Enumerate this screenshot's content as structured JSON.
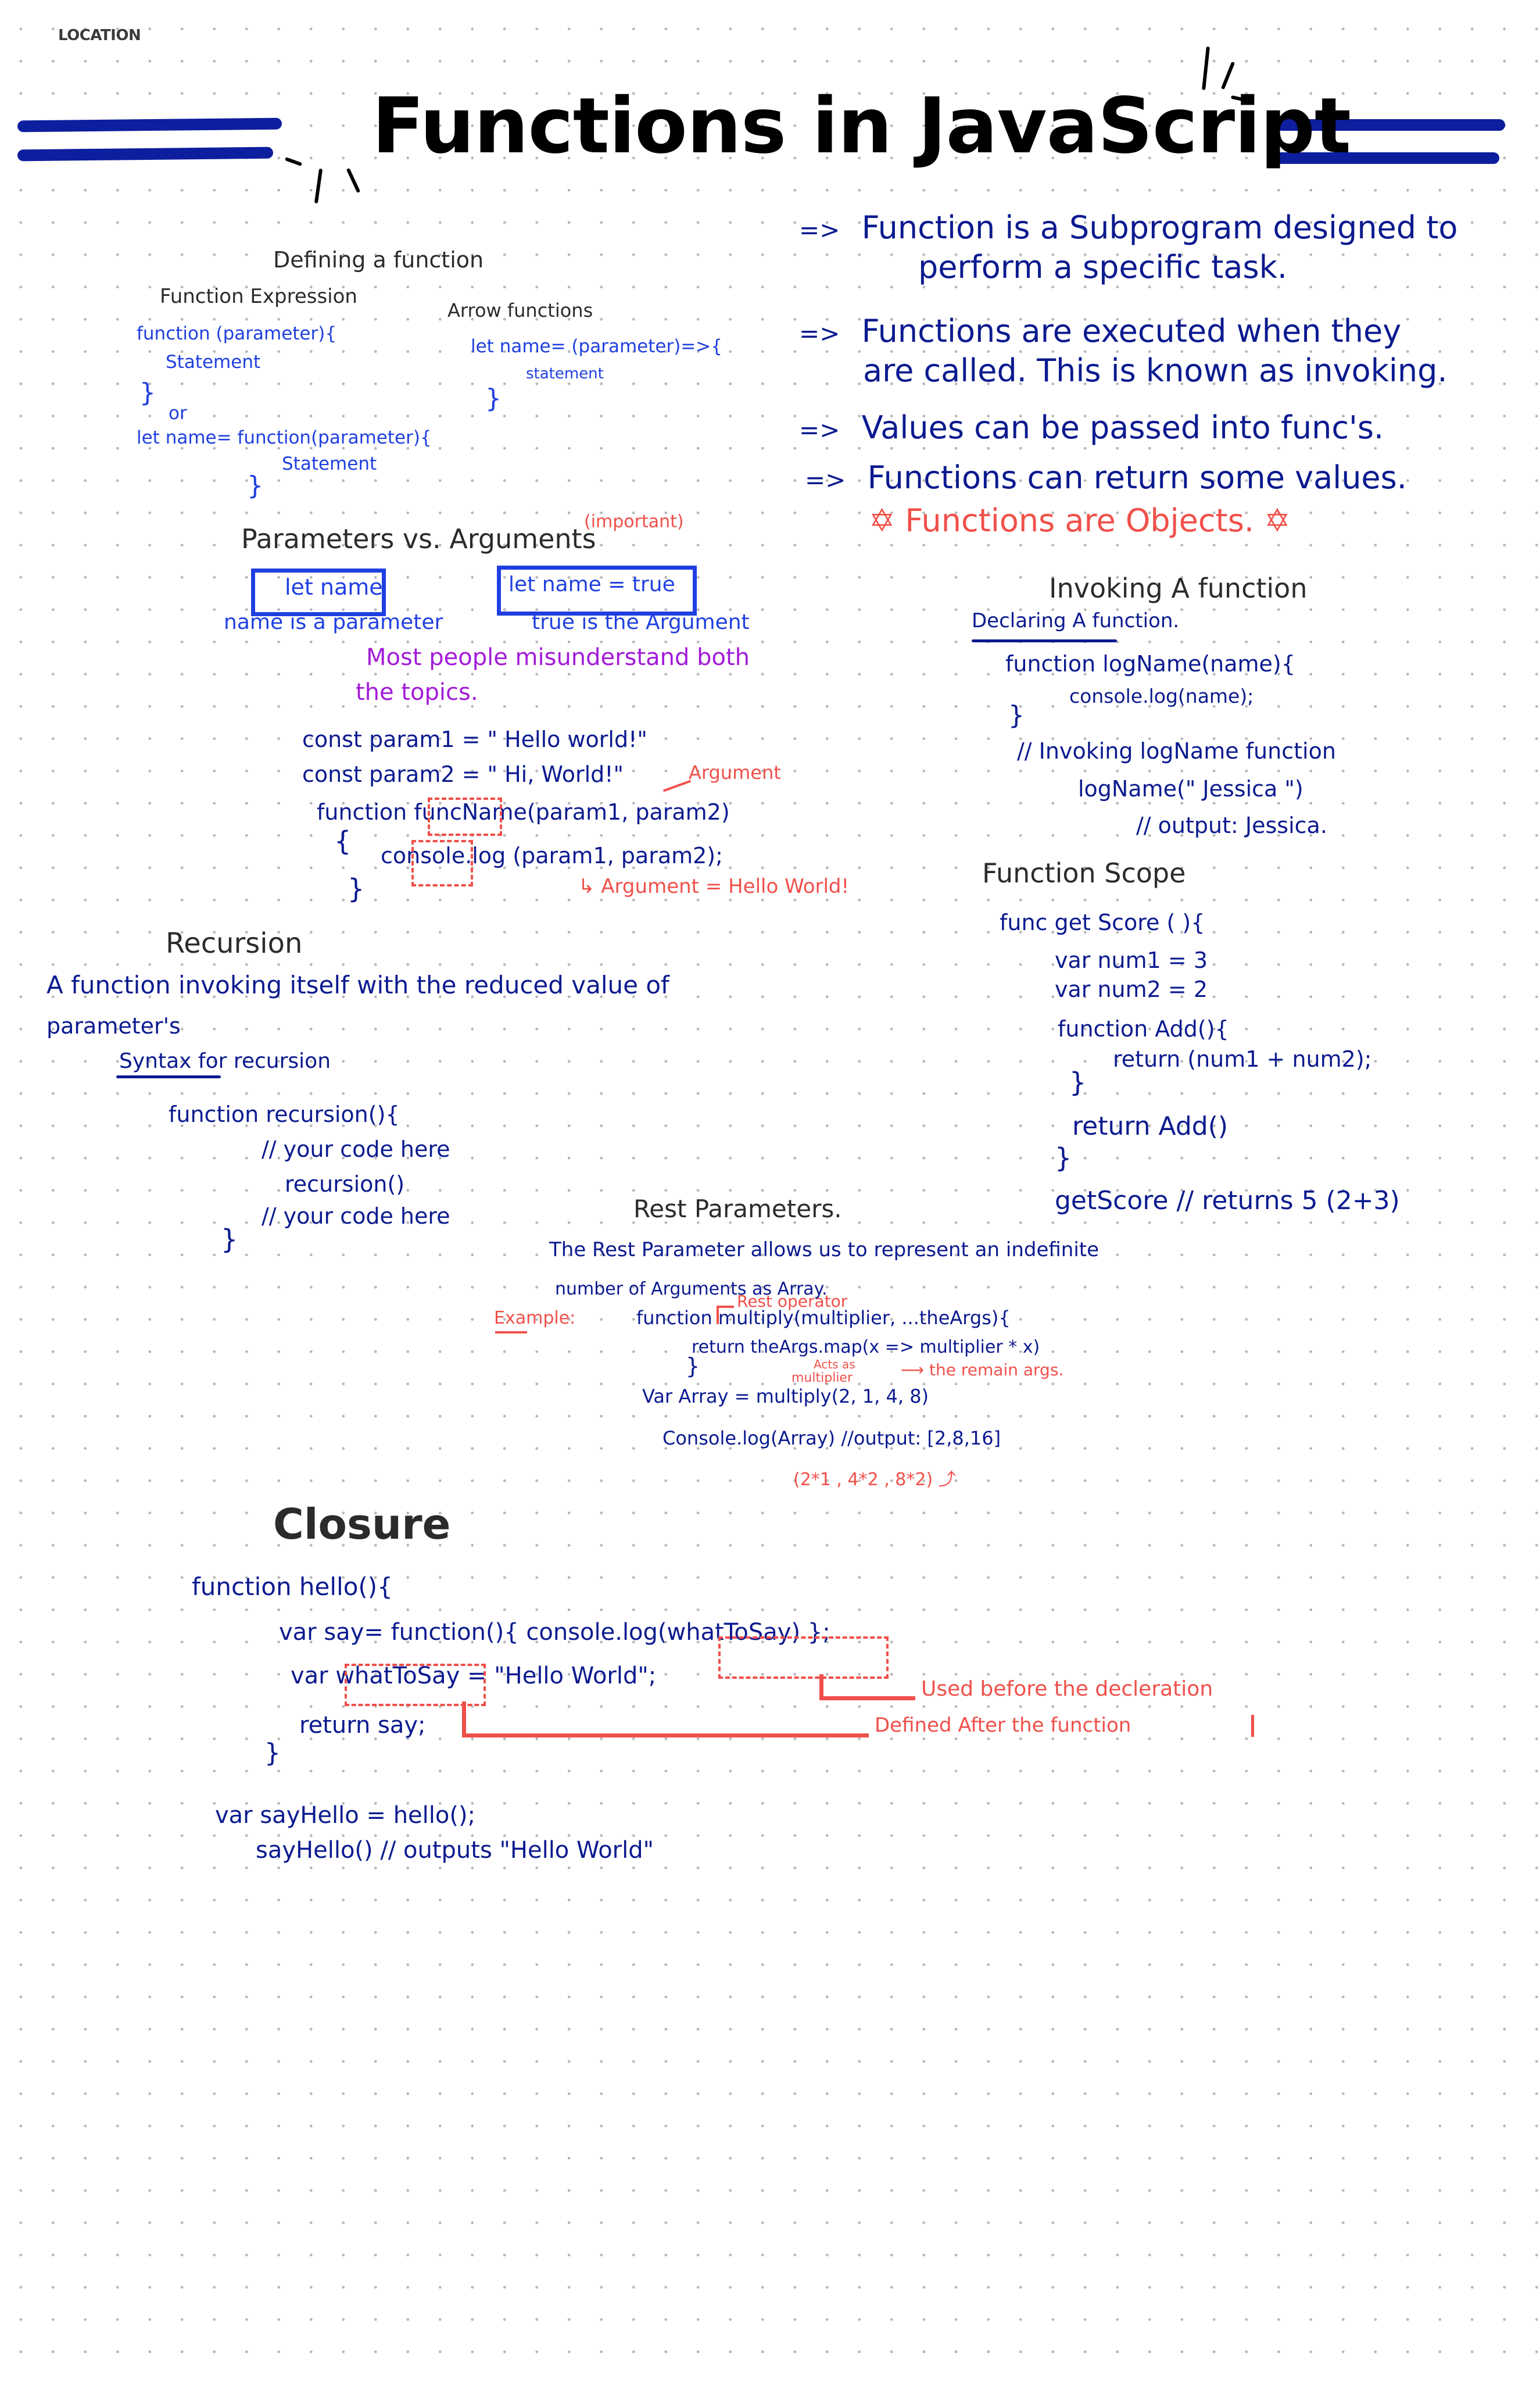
{
  "header": {
    "location_label": "LOCATION",
    "title": "Functions in JavaScript"
  },
  "colors": {
    "accent_blue": "#0b1a8f",
    "bright_blue": "#1f3fe0",
    "annotation_red": "#f0504a",
    "highlight_purple": "#a21bd8",
    "heading_dark": "#2b2b2b"
  },
  "intro_points": [
    {
      "bullet": "=>",
      "text_line1": "Function is a Subprogram designed to",
      "text_line2": "perform a specific task."
    },
    {
      "bullet": "=>",
      "text_line1": "Functions are executed when they",
      "text_line2": "are called. This is known as invoking."
    },
    {
      "bullet": "=>",
      "text_line1": "Values can be passed into func's."
    },
    {
      "bullet": "=>",
      "text_line1": "Functions can return some values."
    }
  ],
  "highlight_fact": {
    "star_icon": "star-of-david",
    "text": "Functions are Objects."
  },
  "defining": {
    "heading": "Defining a function",
    "expression": {
      "heading": "Function Expression",
      "lines": [
        "function (parameter){",
        "Statement",
        "}",
        "or",
        "let name= function(parameter){",
        "Statement",
        "}"
      ]
    },
    "arrow": {
      "heading": "Arrow functions",
      "lines": [
        "let name= (parameter)=>{",
        "statement",
        "}"
      ]
    }
  },
  "params_vs_args": {
    "heading": "Parameters vs. Arguments",
    "tag": "(important)",
    "box_left": "let name",
    "box_right": "let name = true",
    "caption_left": "name is a parameter",
    "caption_right": "true is the Argument",
    "note_line1": "Most people misunderstand both",
    "note_line2": "the topics.",
    "code": [
      "const param1 = \" Hello world!\"",
      "const param2 = \" Hi, World!\"",
      "function funcName(param1, param2)",
      "{",
      "console.log (param1, param2);",
      "}"
    ],
    "annotation_argument": "Argument",
    "annotation_result": "Argument = Hello World!"
  },
  "invoking": {
    "heading": "Invoking A function",
    "subheading": "Declaring A function.",
    "lines": [
      "function logName(name){",
      "console.log(name);",
      "}",
      "// Invoking logName function",
      "logName(\" Jessica \")",
      "// output: Jessica."
    ]
  },
  "scope": {
    "heading": "Function Scope",
    "lines": [
      "func get Score ( ){",
      "var num1 = 3",
      "var num2 = 2",
      "function Add(){",
      "return (num1 + num2);",
      "}",
      "return Add()",
      "}",
      "getScore  // returns 5 (2+3)"
    ]
  },
  "recursion": {
    "heading": "Recursion",
    "desc_line1": "A function invoking itself with the reduced value of",
    "desc_line2": "parameter's",
    "syntax_label": "Syntax for recursion",
    "lines": [
      "function recursion(){",
      "// your code here",
      "recursion()",
      "// your code here",
      "}"
    ]
  },
  "rest": {
    "heading": "Rest Parameters.",
    "desc_line1": "The Rest Parameter allows us to represent an indefinite",
    "desc_line2": "number of Arguments as Array.",
    "example_label": "Example:",
    "lines": [
      "function multiply(multiplier, ...theArgs){",
      "return theArgs.map(x => multiplier * x)",
      "}",
      "Var Array = multiply(2, 1, 4, 8)",
      "Console.log(Array)  //output: [2,8,16]"
    ],
    "annotation_rest_operator": "Rest operator",
    "annotation_acts_as": "Acts as",
    "annotation_multiplier": "multiplier",
    "annotation_remain": "the remain args.",
    "annotation_calc": "(2*1 , 4*2 , 8*2)"
  },
  "closure": {
    "heading": "Closure",
    "lines": [
      "function hello(){",
      "var say= function(){ console.log(whatToSay) };",
      "var whatToSay = \"Hello World\";",
      "return say;",
      "}",
      "var sayHello = hello();",
      "sayHello() // outputs \"Hello World\""
    ],
    "annotation_used": "Used before the decleration",
    "annotation_defined": "Defined After the function"
  }
}
